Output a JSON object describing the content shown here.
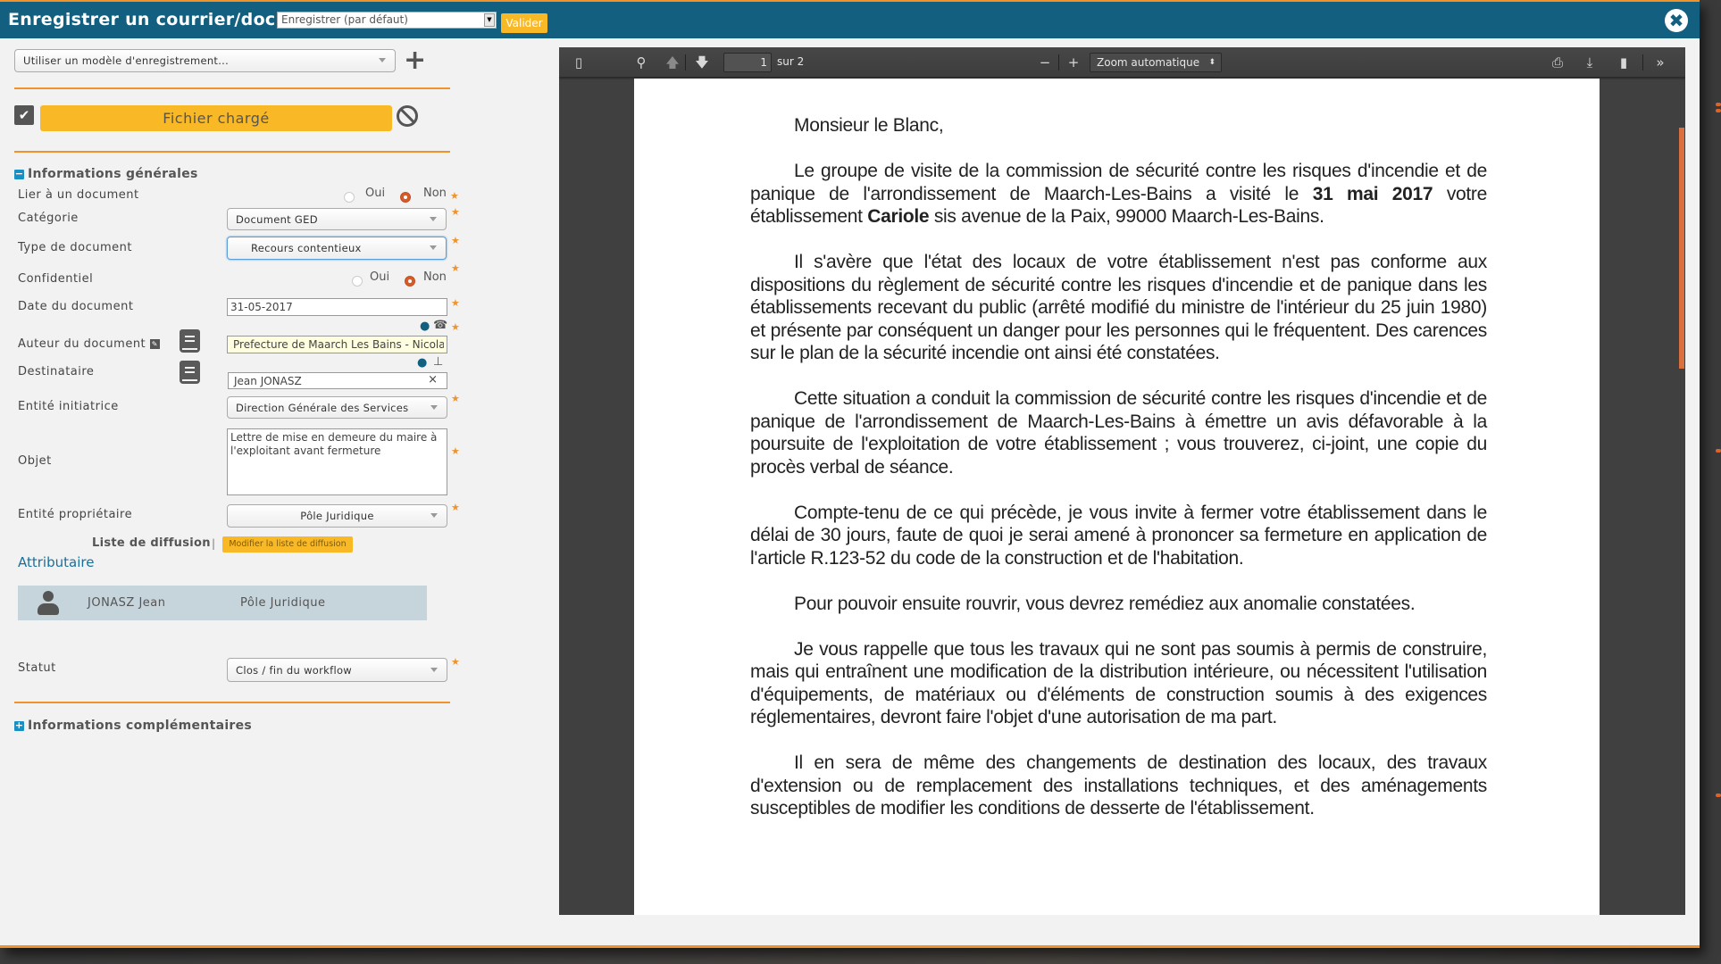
{
  "header": {
    "title": "Enregistrer un courrier/doc :",
    "mode_select": "Enregistrer (par défaut)",
    "valider_label": "Valider",
    "close_icon": "close-circle-icon"
  },
  "form": {
    "model_select": "Utiliser un modèle d'enregistrement...",
    "add_model_icon": "plus-icon",
    "file_loaded_label": "Fichier chargé",
    "general_section": "Informations générales",
    "fields": {
      "link_document": {
        "label": "Lier à un document",
        "options": [
          "Oui",
          "Non"
        ],
        "selected": "Non"
      },
      "category": {
        "label": "Catégorie",
        "value": "Document GED"
      },
      "doc_type": {
        "label": "Type de document",
        "value": "Recours contentieux"
      },
      "confidential": {
        "label": "Confidentiel",
        "options": [
          "Oui",
          "Non"
        ],
        "selected": "Non"
      },
      "doc_date": {
        "label": "Date du document",
        "value": "31-05-2017"
      },
      "author": {
        "label": "Auteur du document",
        "value": "Prefecture de Maarch Les Bains - Nicolas"
      },
      "recipient": {
        "label": "Destinataire",
        "value": "Jean JONASZ",
        "clear": "×"
      },
      "initiating_entity": {
        "label": "Entité initiatrice",
        "value": "Direction Générale des Services"
      },
      "subject": {
        "label": "Objet",
        "value": "Lettre de mise en demeure du maire à l'exploitant avant fermeture"
      },
      "owner_entity": {
        "label": "Entité propriétaire",
        "value": "Pôle Juridique"
      },
      "status": {
        "label": "Statut",
        "value": "Clos / fin du workflow"
      }
    },
    "diffusion": {
      "title": "Liste de diffusion",
      "separator": "|",
      "modify_label": "Modifier la liste de diffusion",
      "attributaire_label": "Attributaire",
      "entries": [
        {
          "name": "JONASZ Jean",
          "entity": "Pôle Juridique"
        }
      ]
    },
    "complementary_section": "Informations complémentaires",
    "required_mark": "★"
  },
  "pdf_viewer": {
    "current_page": "1",
    "page_of": "sur 2",
    "zoom": "Zoom automatique",
    "letter": {
      "salutation": "Monsieur le Blanc,",
      "p1_a": "Le groupe de visite de la commission de sécurité contre les risques d'incendie et de panique de l'arrondissement de Maarch-Les-Bains a visité le ",
      "p1_date": "31 mai 2017",
      "p1_b": " votre établissement ",
      "p1_name": "Cariole",
      "p1_c": " sis avenue de la Paix, 99000 Maarch-Les-Bains.",
      "p2": "Il s'avère que l'état des locaux de votre établissement n'est pas conforme aux dispositions du règlement de sécurité contre les risques d'incendie et de panique dans les établissements recevant du public (arrêté modifié du ministre de l'intérieur du 25 juin 1980) et présente par conséquent un danger pour les personnes qui le fréquentent. Des carences sur le plan de la sécurité incendie ont ainsi été constatées.",
      "p3": "Cette situation a conduit la commission de sécurité contre les risques d'incendie et de panique de l'arrondissement de Maarch-Les-Bains à émettre un avis défavorable à la poursuite de l'exploitation de votre établissement ; vous trouverez, ci-joint, une copie du procès verbal de séance.",
      "p4": "Compte-tenu de ce qui précède, je vous invite à fermer votre établissement dans le délai de 30 jours, faute de quoi je serai amené à prononcer sa fermeture en application de l'article R.123-52 du code de la construction et de l'habitation.",
      "p5": "Pour pouvoir ensuite rouvrir, vous devrez remédiez aux anomalie constatées.",
      "p6": "Je vous rappelle que tous les travaux qui ne sont pas soumis à permis de construire, mais qui entraînent une modification de la distribution intérieure, ou nécessitent l'utilisation d'équipements, de matériaux ou d'éléments de construction soumis à des exigences réglementaires, devront faire l'objet d'une autorisation de ma part.",
      "p7": "Il en sera de même des changements de destination des locaux, des travaux d'extension ou de remplacement des installations techniques, et des aménagements susceptibles de modifier les conditions de desserte de l'établissement."
    }
  },
  "colors": {
    "header_bg": "#135f7f",
    "accent_orange": "#f0932b",
    "button_yellow": "#f9b927",
    "radio_selected": "#d35b2c",
    "diffusion_row_bg": "#c6d4dc"
  }
}
